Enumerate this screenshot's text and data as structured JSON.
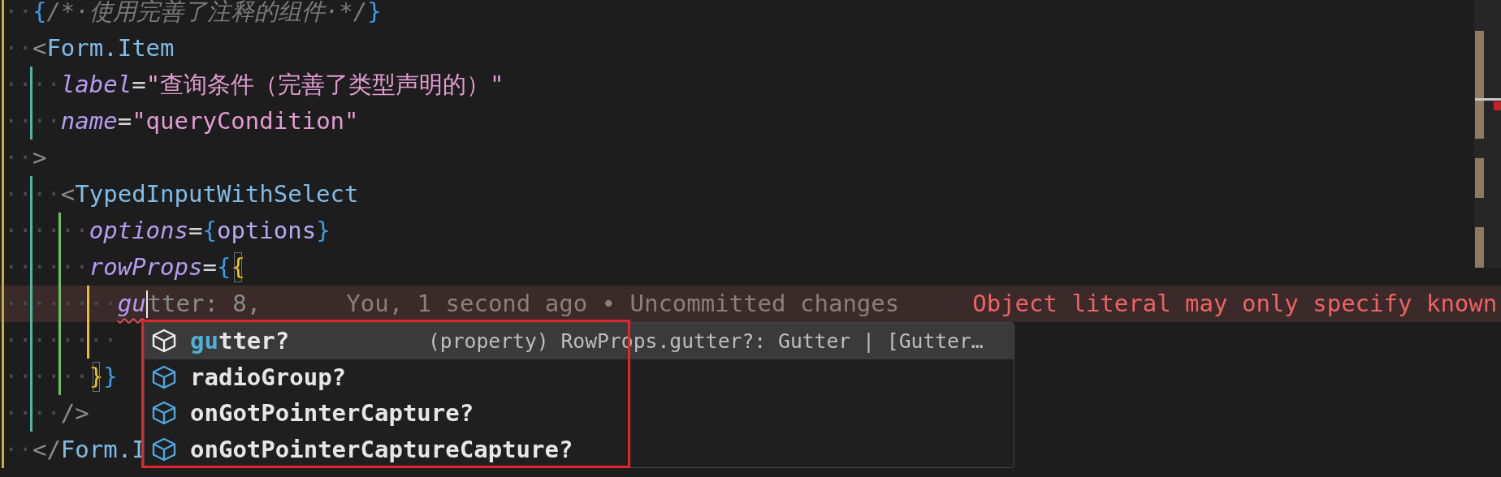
{
  "editor": {
    "lines": [
      {
        "tokens": [
          {
            "kind": "ws",
            "text": "··",
            "color": "#c8b040"
          },
          {
            "kind": "brace",
            "text": "{"
          },
          {
            "kind": "comment",
            "text": "/*·使用完善了注释的组件·*/"
          },
          {
            "kind": "brace",
            "text": "}"
          }
        ]
      },
      {
        "tokens": [
          {
            "kind": "ws",
            "text": "··",
            "color": "#c8b040"
          },
          {
            "kind": "punct",
            "text": "<"
          },
          {
            "kind": "tag",
            "text": "Form.Item"
          }
        ]
      },
      {
        "tokens": [
          {
            "kind": "ws",
            "text": "··",
            "color": "#c8b040"
          },
          {
            "kind": "ws",
            "text": "··",
            "color": "#4fb8a0"
          },
          {
            "kind": "attr",
            "text": "label"
          },
          {
            "kind": "op",
            "text": "="
          },
          {
            "kind": "string",
            "text": "\"查询条件（完善了类型声明的）\""
          }
        ]
      },
      {
        "tokens": [
          {
            "kind": "ws",
            "text": "··",
            "color": "#c8b040"
          },
          {
            "kind": "ws",
            "text": "··",
            "color": "#4fb8a0"
          },
          {
            "kind": "attr",
            "text": "name"
          },
          {
            "kind": "op",
            "text": "="
          },
          {
            "kind": "string",
            "text": "\"queryCondition\""
          }
        ]
      },
      {
        "tokens": [
          {
            "kind": "ws",
            "text": "··",
            "color": "#c8b040"
          },
          {
            "kind": "punct",
            "text": ">"
          }
        ]
      },
      {
        "tokens": [
          {
            "kind": "ws",
            "text": "··",
            "color": "#c8b040"
          },
          {
            "kind": "ws",
            "text": "··",
            "color": "#4fb8a0"
          },
          {
            "kind": "punct",
            "text": "<"
          },
          {
            "kind": "tag",
            "text": "TypedInputWithSelect"
          }
        ]
      },
      {
        "tokens": [
          {
            "kind": "ws",
            "text": "··",
            "color": "#c8b040"
          },
          {
            "kind": "ws",
            "text": "··",
            "color": "#4fb8a0"
          },
          {
            "kind": "ws",
            "text": "··",
            "color": "#6fbf60"
          },
          {
            "kind": "attr",
            "text": "options"
          },
          {
            "kind": "op",
            "text": "="
          },
          {
            "kind": "brace",
            "text": "{"
          },
          {
            "kind": "var",
            "text": "options"
          },
          {
            "kind": "brace",
            "text": "}"
          }
        ]
      },
      {
        "tokens": [
          {
            "kind": "ws",
            "text": "··",
            "color": "#c8b040"
          },
          {
            "kind": "ws",
            "text": "··",
            "color": "#4fb8a0"
          },
          {
            "kind": "ws",
            "text": "··",
            "color": "#6fbf60"
          },
          {
            "kind": "attr",
            "text": "rowProps"
          },
          {
            "kind": "op",
            "text": "="
          },
          {
            "kind": "brace",
            "text": "{"
          },
          {
            "kind": "brace2",
            "text": "{",
            "matched": true
          }
        ]
      },
      {
        "current": true,
        "blame": "You, 1 second ago • Uncommitted changes",
        "diagnostic": "Object literal may only specify known",
        "tokens": [
          {
            "kind": "ws",
            "text": "··",
            "color": "#c8b040"
          },
          {
            "kind": "ws",
            "text": "··",
            "color": "#4fb8a0"
          },
          {
            "kind": "ws",
            "text": "··",
            "color": "#6fbf60"
          },
          {
            "kind": "ws",
            "text": "··",
            "color": "#e8c020"
          },
          {
            "kind": "attr",
            "text": "gu",
            "error": true,
            "cursor": true
          },
          {
            "kind": "dim",
            "text": "tter: 8,"
          }
        ]
      },
      {
        "tokens": [
          {
            "kind": "ws",
            "text": "··",
            "color": "#c8b040"
          },
          {
            "kind": "ws",
            "text": "··",
            "color": "#4fb8a0"
          },
          {
            "kind": "ws",
            "text": "··",
            "color": "#6fbf60"
          },
          {
            "kind": "ws",
            "text": "··",
            "color": "#e8c020"
          }
        ]
      },
      {
        "tokens": [
          {
            "kind": "ws",
            "text": "··",
            "color": "#c8b040"
          },
          {
            "kind": "ws",
            "text": "··",
            "color": "#4fb8a0"
          },
          {
            "kind": "ws",
            "text": "··",
            "color": "#6fbf60"
          },
          {
            "kind": "brace2",
            "text": "}",
            "matched": true
          },
          {
            "kind": "brace",
            "text": "}"
          }
        ]
      },
      {
        "tokens": [
          {
            "kind": "ws",
            "text": "··",
            "color": "#c8b040"
          },
          {
            "kind": "ws",
            "text": "··",
            "color": "#4fb8a0"
          },
          {
            "kind": "punct",
            "text": "/>"
          }
        ]
      },
      {
        "tokens": [
          {
            "kind": "ws",
            "text": "··",
            "color": "#c8b040"
          },
          {
            "kind": "punct",
            "text": "</"
          },
          {
            "kind": "tag",
            "text": "Form.I"
          }
        ]
      }
    ],
    "suggest": {
      "items": [
        {
          "match": "gu",
          "label": "tter?",
          "detail": "(property) RowProps.gutter?: Gutter | [Gutter…",
          "selected": true
        },
        {
          "label": "radioGroup?",
          "selected": false
        },
        {
          "label": "onGotPointerCapture?",
          "selected": false
        },
        {
          "label": "onGotPointerCaptureCapture?",
          "selected": false
        }
      ]
    }
  }
}
